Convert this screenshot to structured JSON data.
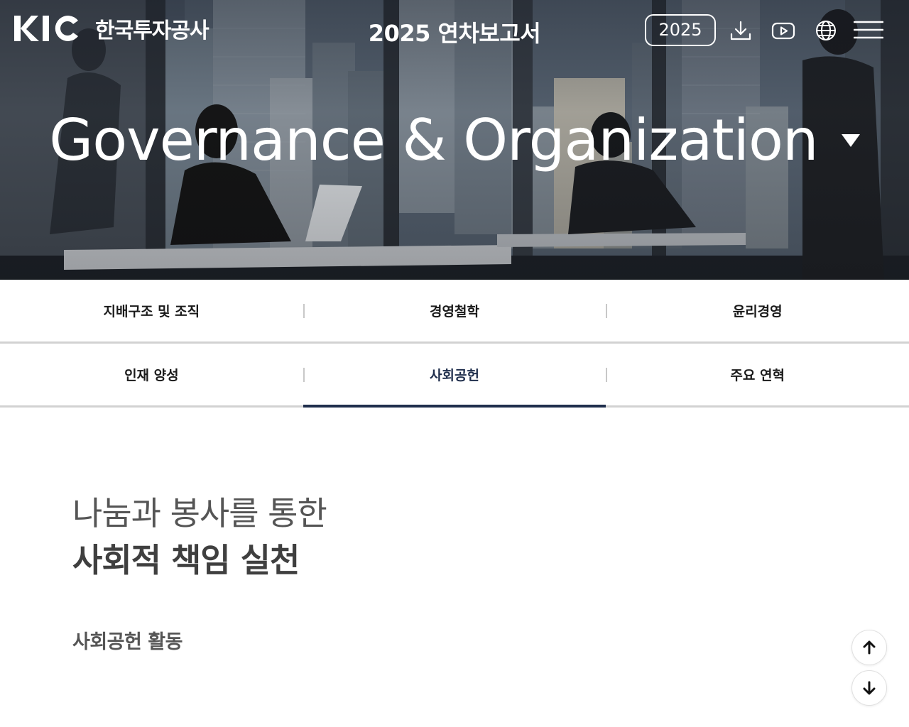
{
  "header": {
    "logo_mark": "KIC",
    "logo_text": "한국투자공사",
    "report_title": "2025 연차보고서",
    "year_button": "2025",
    "icons": [
      "download-icon",
      "youtube-icon",
      "globe-icon",
      "menu-icon"
    ]
  },
  "hero": {
    "title": "Governance & Organization",
    "caret_icon": "caret-down-icon"
  },
  "tabs": {
    "row1": [
      {
        "label": "지배구조 및 조직",
        "active": false
      },
      {
        "label": "경영철학",
        "active": false
      },
      {
        "label": "윤리경영",
        "active": false
      }
    ],
    "row2": [
      {
        "label": "인재 양성",
        "active": false
      },
      {
        "label": "사회공헌",
        "active": true
      },
      {
        "label": "주요 연혁",
        "active": false
      }
    ]
  },
  "content": {
    "headline_line1": "나눔과 봉사를 통한",
    "headline_line2": "사회적 책임 실천",
    "section_label": "사회공헌 활동"
  },
  "scroll": {
    "up_icon": "arrow-up-icon",
    "down_icon": "arrow-down-icon"
  },
  "colors": {
    "accent": "#1f2e4c",
    "tab_divider": "#d2d2d2",
    "headline": "#555555"
  }
}
